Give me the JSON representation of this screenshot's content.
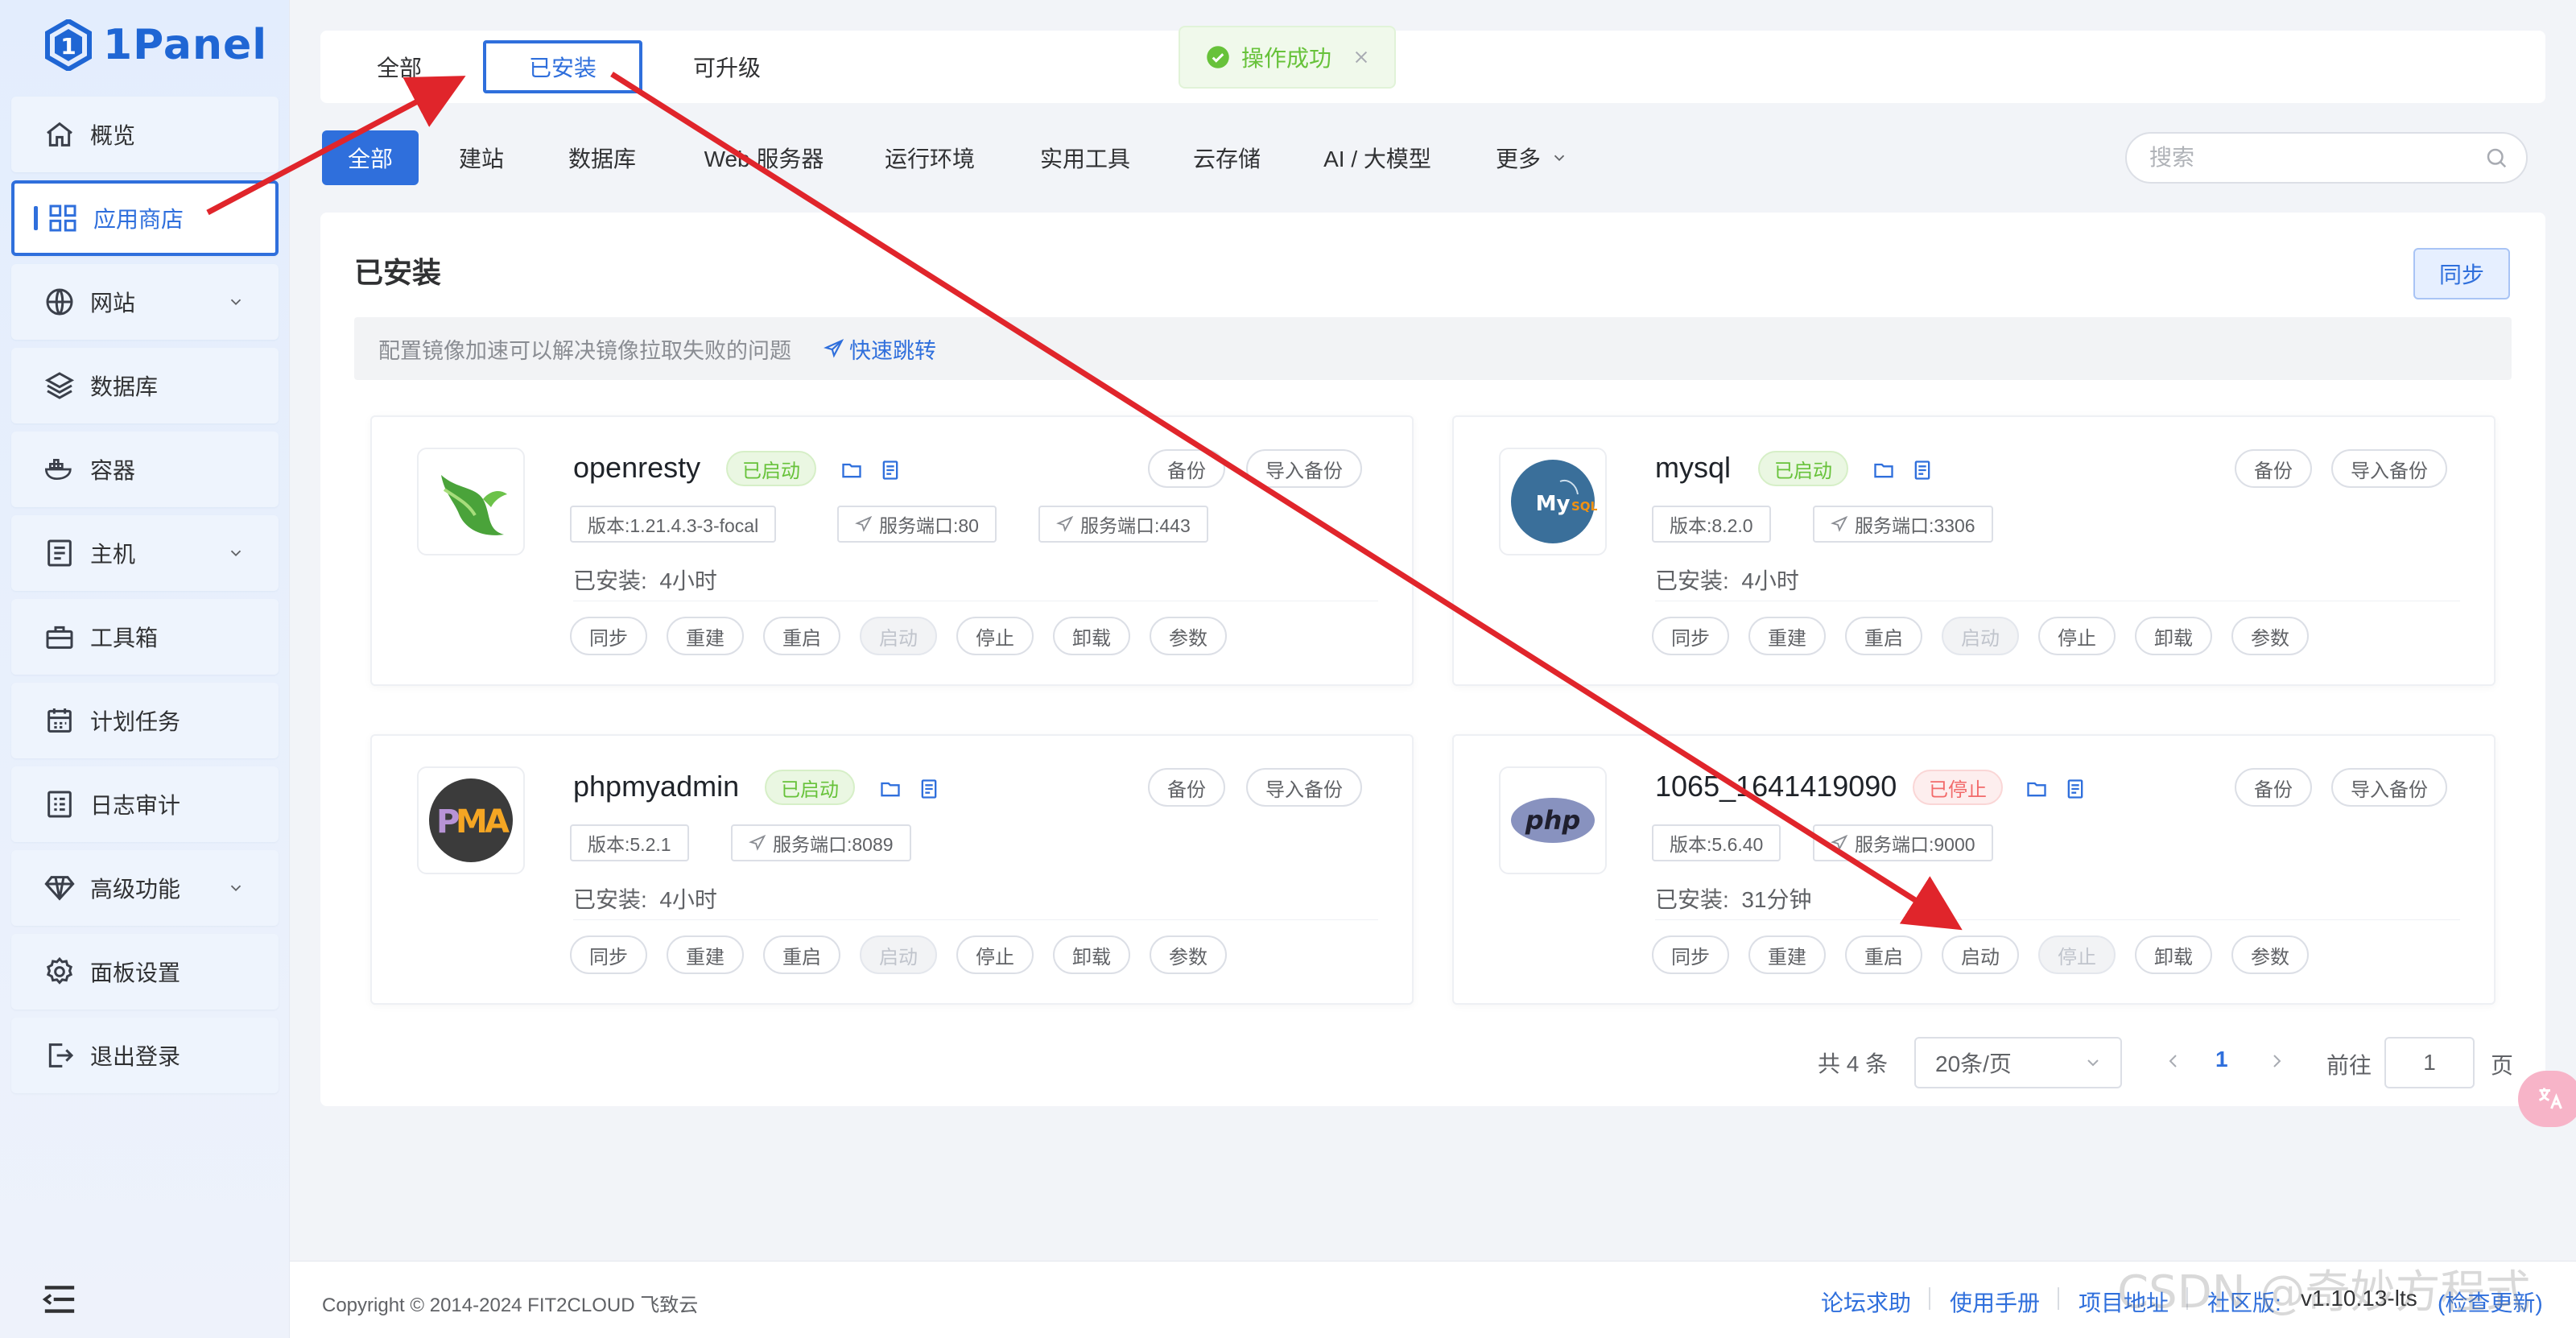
{
  "app": {
    "name": "1Panel"
  },
  "sidebar": {
    "items": [
      {
        "label": "概览",
        "icon": "home-icon",
        "expandable": false
      },
      {
        "label": "应用商店",
        "icon": "grid-icon",
        "expandable": false,
        "active": true
      },
      {
        "label": "网站",
        "icon": "globe-icon",
        "expandable": true
      },
      {
        "label": "数据库",
        "icon": "layers-icon",
        "expandable": false
      },
      {
        "label": "容器",
        "icon": "docker-icon",
        "expandable": false
      },
      {
        "label": "主机",
        "icon": "server-icon",
        "expandable": true
      },
      {
        "label": "工具箱",
        "icon": "toolbox-icon",
        "expandable": false
      },
      {
        "label": "计划任务",
        "icon": "calendar-icon",
        "expandable": false
      },
      {
        "label": "日志审计",
        "icon": "log-icon",
        "expandable": false
      },
      {
        "label": "高级功能",
        "icon": "diamond-icon",
        "expandable": true
      },
      {
        "label": "面板设置",
        "icon": "gear-icon",
        "expandable": false
      },
      {
        "label": "退出登录",
        "icon": "logout-icon",
        "expandable": false
      }
    ]
  },
  "top_tabs": [
    {
      "label": "全部"
    },
    {
      "label": "已安装",
      "active": true
    },
    {
      "label": "可升级"
    }
  ],
  "toast": {
    "text": "操作成功"
  },
  "categories": [
    {
      "label": "全部",
      "active": true
    },
    {
      "label": "建站"
    },
    {
      "label": "数据库"
    },
    {
      "label": "Web 服务器"
    },
    {
      "label": "运行环境"
    },
    {
      "label": "实用工具"
    },
    {
      "label": "云存储"
    },
    {
      "label": "AI / 大模型"
    },
    {
      "label": "更多"
    }
  ],
  "search": {
    "placeholder": "搜索"
  },
  "panel": {
    "title": "已安装",
    "sync_label": "同步",
    "notice": "配置镜像加速可以解决镜像拉取失败的问题",
    "notice_link": "快速跳转"
  },
  "labels": {
    "backup": "备份",
    "import_backup": "导入备份",
    "installed_prefix": "已安装:",
    "actions": [
      "同步",
      "重建",
      "重启",
      "启动",
      "停止",
      "卸载",
      "参数"
    ]
  },
  "apps": [
    {
      "name": "openresty",
      "status": "已启动",
      "running": true,
      "version": "版本:1.21.4.3-3-focal",
      "ports": [
        "服务端口:80",
        "服务端口:443"
      ],
      "installed": "4小时",
      "logo": "openresty-logo",
      "disabled_action": "启动"
    },
    {
      "name": "mysql",
      "status": "已启动",
      "running": true,
      "version": "版本:8.2.0",
      "ports": [
        "服务端口:3306"
      ],
      "installed": "4小时",
      "logo": "mysql-logo",
      "disabled_action": "启动"
    },
    {
      "name": "phpmyadmin",
      "status": "已启动",
      "running": true,
      "version": "版本:5.2.1",
      "ports": [
        "服务端口:8089"
      ],
      "installed": "4小时",
      "logo": "phpmyadmin-logo",
      "disabled_action": "启动"
    },
    {
      "name": "1065_1641419090",
      "status": "已停止",
      "running": false,
      "version": "版本:5.6.40",
      "ports": [
        "服务端口:9000"
      ],
      "installed": "31分钟",
      "logo": "php-logo",
      "disabled_action": "停止"
    }
  ],
  "pagination": {
    "total": "共 4 条",
    "page_size": "20条/页",
    "current_page": "1",
    "goto_label": "前往",
    "goto_value": "1",
    "page_unit": "页"
  },
  "footer": {
    "copyright": "Copyright © 2014-2024 FIT2CLOUD 飞致云",
    "links": [
      "论坛求助",
      "使用手册",
      "项目地址",
      "社区版:"
    ],
    "version": "v1.10.13-lts",
    "check_update": "(检查更新)"
  },
  "watermark": "CSDN @奇妙方程式",
  "colors": {
    "primary": "#2f6fdc",
    "success": "#67c23a",
    "danger": "#f26a6a",
    "annotation_red": "#e0252b"
  }
}
